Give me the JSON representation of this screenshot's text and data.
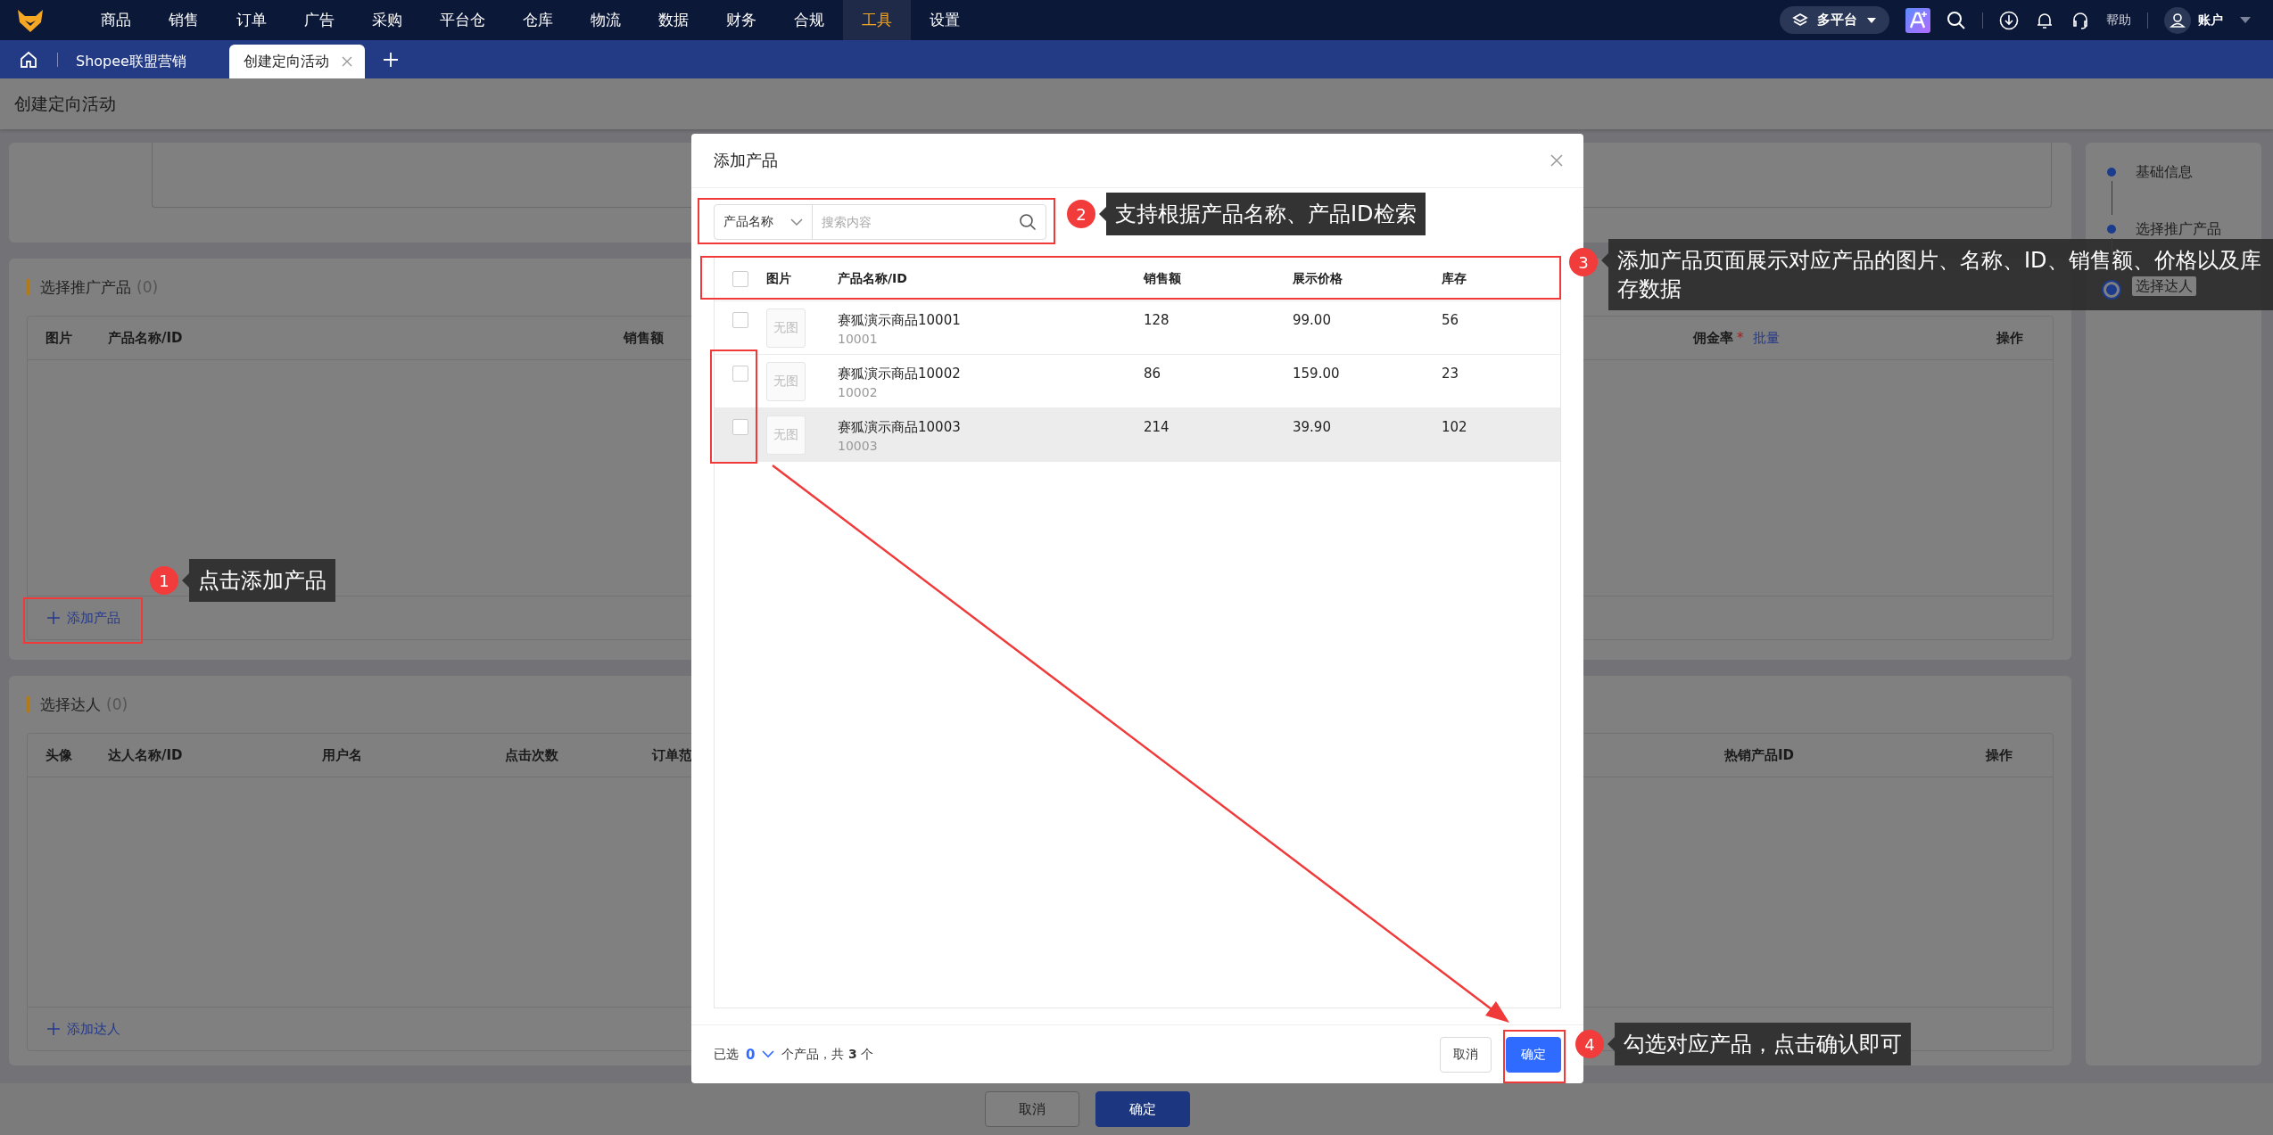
{
  "nav": {
    "menu": [
      {
        "label": "商品",
        "selected": false
      },
      {
        "label": "销售",
        "selected": false
      },
      {
        "label": "订单",
        "selected": false
      },
      {
        "label": "广告",
        "selected": false
      },
      {
        "label": "采购",
        "selected": false
      },
      {
        "label": "平台仓",
        "selected": false
      },
      {
        "label": "仓库",
        "selected": false
      },
      {
        "label": "物流",
        "selected": false
      },
      {
        "label": "数据",
        "selected": false
      },
      {
        "label": "财务",
        "selected": false
      },
      {
        "label": "合规",
        "selected": false
      },
      {
        "label": "工具",
        "selected": true
      },
      {
        "label": "设置",
        "selected": false
      }
    ],
    "platform": "多平台",
    "help": "帮助",
    "account": "账户"
  },
  "tabs": [
    {
      "label": "Shopee联盟营销",
      "selected": false,
      "closable": false
    },
    {
      "label": "创建定向活动",
      "selected": true,
      "closable": true
    }
  ],
  "page": {
    "title": "创建定向活动",
    "products_section": {
      "title": "选择推广产品",
      "count": "(0)",
      "columns": [
        {
          "label": "图片"
        },
        {
          "label": "产品名称/ID"
        },
        {
          "label": "销售额"
        },
        {
          "label": "佣金率",
          "asterisk": "*",
          "link": "批量"
        },
        {
          "label": "操作"
        }
      ],
      "add_button": "添加产品"
    },
    "talents_section": {
      "title": "选择达人",
      "count": "(0)",
      "columns": [
        {
          "label": "头像"
        },
        {
          "label": "达人名称/ID"
        },
        {
          "label": "用户名"
        },
        {
          "label": "点击次数"
        },
        {
          "label": "订单范"
        },
        {
          "label": "热销产品ID"
        },
        {
          "label": "操作"
        }
      ],
      "add_button": "添加达人"
    },
    "footer_buttons": [
      {
        "label": "取消",
        "kind": "default"
      },
      {
        "label": "确定",
        "kind": "primary"
      }
    ]
  },
  "steps": [
    {
      "label": "基础信息",
      "current": false
    },
    {
      "label": "选择推广产品",
      "current": false
    },
    {
      "label": "选择达人",
      "current": true
    }
  ],
  "modal": {
    "title": "添加产品",
    "search": {
      "field": "产品名称",
      "placeholder": "搜索内容"
    },
    "columns": [
      "图片",
      "产品名称/ID",
      "销售额",
      "展示价格",
      "库存"
    ],
    "header_checked": false,
    "rows": [
      {
        "checked": false,
        "highlighted": false,
        "image": "无图",
        "name": "赛狐演示商品10001",
        "id": "10001",
        "sales": "128",
        "price": "99.00",
        "stock": "56"
      },
      {
        "checked": false,
        "highlighted": false,
        "image": "无图",
        "name": "赛狐演示商品10002",
        "id": "10002",
        "sales": "86",
        "price": "159.00",
        "stock": "23"
      },
      {
        "checked": false,
        "highlighted": true,
        "image": "无图",
        "name": "赛狐演示商品10003",
        "id": "10003",
        "sales": "214",
        "price": "39.90",
        "stock": "102"
      }
    ],
    "footer": {
      "selected_label": "已选",
      "selected_count": "0",
      "summary": "个产品，共 **3** 个"
    },
    "buttons": [
      {
        "label": "取消",
        "kind": "default"
      },
      {
        "label": "确定",
        "kind": "primary"
      }
    ]
  },
  "annotations": [
    {
      "number": "1",
      "text": "点击添加产品"
    },
    {
      "number": "2",
      "text": "支持根据产品名称、产品ID检索"
    },
    {
      "number": "3",
      "text": "添加产品页面展示对应产品的图片、名称、ID、销售额、价格以及库存数据"
    },
    {
      "number": "4",
      "text": "勾选对应产品，点击确认即可"
    }
  ]
}
